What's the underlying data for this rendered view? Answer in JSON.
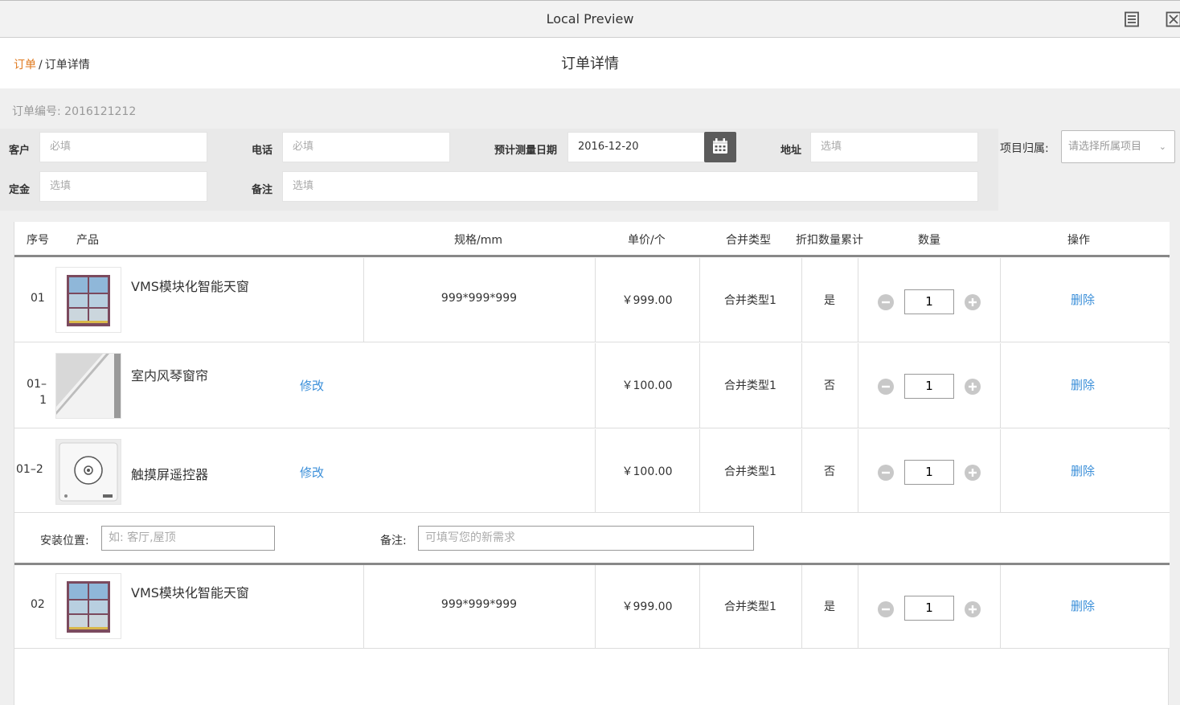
{
  "window": {
    "title": "Local Preview"
  },
  "breadcrumb": {
    "parent": "订单",
    "separator": "/",
    "current": "订单详情"
  },
  "page_title": "订单详情",
  "order": {
    "number_label": "订单编号: 2016121212"
  },
  "form": {
    "customer": {
      "label": "客户",
      "placeholder": "必填"
    },
    "phone": {
      "label": "电话",
      "placeholder": "必填"
    },
    "measure_date": {
      "label": "预计测量日期",
      "value": "2016-12-20"
    },
    "address": {
      "label": "地址",
      "placeholder": "选填"
    },
    "deposit": {
      "label": "定金",
      "placeholder": "选填"
    },
    "remark": {
      "label": "备注",
      "placeholder": "选填"
    },
    "project": {
      "label": "项目归属:",
      "placeholder": "请选择所属项目"
    }
  },
  "table": {
    "headers": {
      "seq": "序号",
      "product": "产品",
      "spec": "规格/mm",
      "price": "单价/个",
      "merge": "合并类型",
      "discount": "折扣数量累计",
      "qty": "数量",
      "ops": "操作"
    },
    "rows": [
      {
        "seq": "01",
        "name": "VMS模块化智能天窗",
        "edit": "",
        "spec": "999*999*999",
        "price": "￥999.00",
        "merge": "合并类型1",
        "discount": "是",
        "qty": "1",
        "op": "删除"
      },
      {
        "seq": "01–\n1",
        "name": "室内风琴窗帘",
        "edit": "修改",
        "spec": "",
        "price": "￥100.00",
        "merge": "合并类型1",
        "discount": "否",
        "qty": "1",
        "op": "删除"
      },
      {
        "seq": "01–2",
        "name": "触摸屏遥控器",
        "edit": "修改",
        "spec": "",
        "price": "￥100.00",
        "merge": "合并类型1",
        "discount": "否",
        "qty": "1",
        "op": "删除"
      },
      {
        "seq": "02",
        "name": "VMS模块化智能天窗",
        "edit": "",
        "spec": "999*999*999",
        "price": "￥999.00",
        "merge": "合并类型1",
        "discount": "是",
        "qty": "1",
        "op": "删除"
      }
    ],
    "extra": {
      "install_label": "安装位置:",
      "install_placeholder": "如: 客厅,屋顶",
      "remark_label": "备注:",
      "remark_placeholder": "可填写您的新需求"
    }
  },
  "colors": {
    "accent_orange": "#e07a1f",
    "link_blue": "#3b8fd9",
    "date_button": "#5b5b5b"
  },
  "icons": {
    "list": "list-icon",
    "close": "close-icon",
    "calendar": "calendar-icon",
    "minus": "minus-circle-icon",
    "plus": "plus-circle-icon",
    "chevron": "chevron-down-icon"
  }
}
